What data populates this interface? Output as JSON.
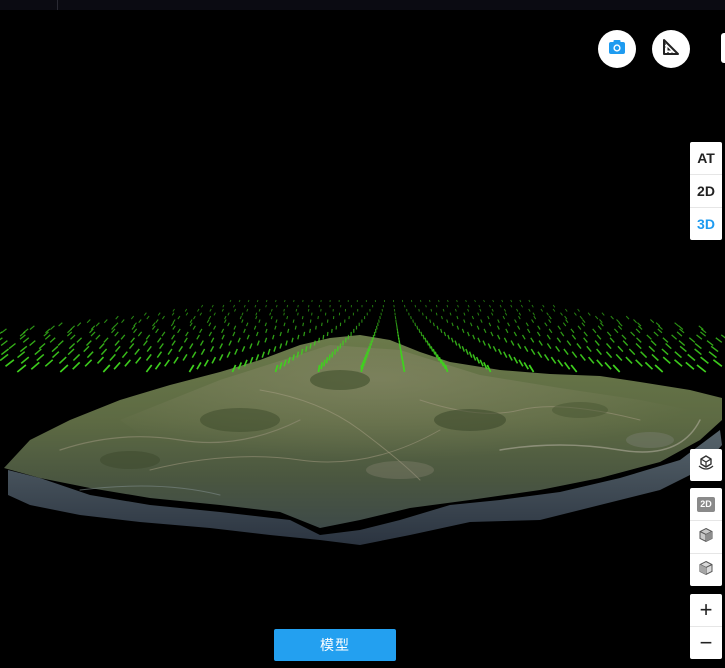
{
  "toolbar": {
    "camera_icon": "camera-icon",
    "measure_icon": "ruler-triangle-icon"
  },
  "view_modes": {
    "items": [
      {
        "label": "AT",
        "active": false
      },
      {
        "label": "2D",
        "active": false
      },
      {
        "label": "3D",
        "active": true
      }
    ],
    "active_color": "#1e9bf0"
  },
  "layer_tools": {
    "basemap_icon": "layers-globe-icon",
    "label_2d": "2D",
    "model_icon_1": "cube-icon",
    "model_icon_2": "cube-icon"
  },
  "zoom": {
    "in_label": "+",
    "out_label": "−"
  },
  "bottom": {
    "model_label": "模型"
  },
  "colors": {
    "background": "#000000",
    "accent": "#23a0f0",
    "camera_points": "#3fd21e"
  }
}
